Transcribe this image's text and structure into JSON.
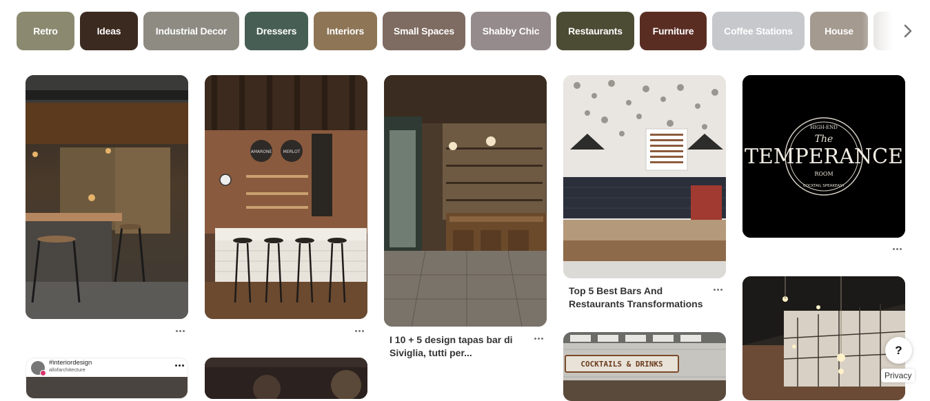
{
  "categories": [
    {
      "label": "Retro",
      "color": "#8b8a70"
    },
    {
      "label": "Ideas",
      "color": "#3b2a1f"
    },
    {
      "label": "Industrial Decor",
      "color": "#8d8b82"
    },
    {
      "label": "Dressers",
      "color": "#475e54"
    },
    {
      "label": "Interiors",
      "color": "#8d7556"
    },
    {
      "label": "Small Spaces",
      "color": "#7e6b61"
    },
    {
      "label": "Shabby Chic",
      "color": "#958a8c"
    },
    {
      "label": "Restaurants",
      "color": "#4c4b34"
    },
    {
      "label": "Furniture",
      "color": "#5a2d23"
    },
    {
      "label": "Coffee Stations",
      "color": "#c6c8cc"
    },
    {
      "label": "House",
      "color": "#a49a8f"
    },
    {
      "label": "",
      "color": "#d9d7d2"
    }
  ],
  "pins": {
    "pin1": {
      "alt": ""
    },
    "pin3": {
      "title": "I 10 + 5 design tapas bar di Siviglia, tutti per..."
    },
    "pin4": {
      "title": "Top 5 Best Bars And Restaurants Transformations"
    },
    "pin5": {
      "logo_line1": "HIGH-END",
      "logo_main": "TEMPERANCE",
      "logo_the": "The",
      "logo_room": "ROOM",
      "logo_bottom": "COCKTAIL SPEAKEASY"
    },
    "pin6": {
      "hashtag": "#interiordesign",
      "account": "allofarchitecture"
    },
    "pin8": {
      "sign": "COCKTAILS & DRINKS"
    },
    "barrels": [
      "AMARONE",
      "MERLOT"
    ]
  },
  "help_label": "?",
  "privacy_label": "Privacy"
}
